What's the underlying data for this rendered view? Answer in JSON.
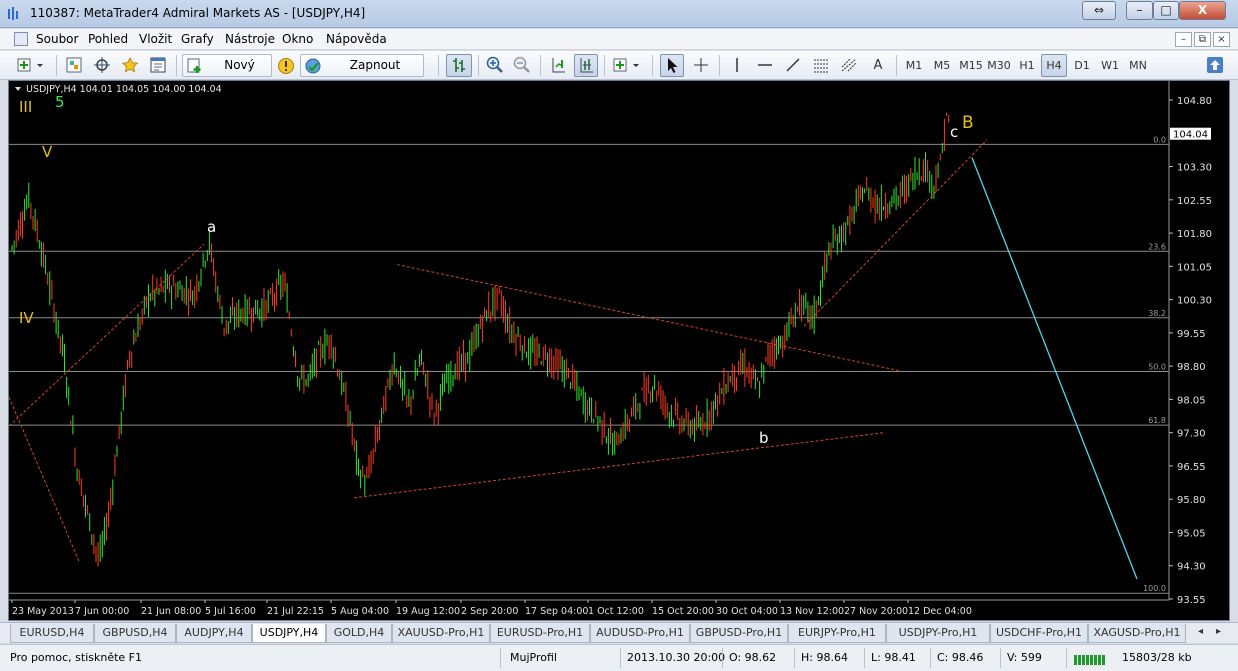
{
  "window": {
    "title": "110387: MetaTrader4 Admiral Markets AS - [USDJPY,H4]",
    "controls": {
      "minimize": "–",
      "maximize": "□",
      "close": "X",
      "restore": "⇔"
    }
  },
  "menu": {
    "items": [
      "Soubor",
      "Pohled",
      "Vložit",
      "Grafy",
      "Nástroje",
      "Okno",
      "Nápověda"
    ],
    "mdi_controls": [
      "–",
      "⧉",
      "×"
    ]
  },
  "toolbar": {
    "new_order_label": "Nový pokyn",
    "strategy_label": "Zapnout strategie",
    "text_tool": "A",
    "timeframes": [
      "M1",
      "M5",
      "M15",
      "M30",
      "H1",
      "H4",
      "D1",
      "W1",
      "MN"
    ],
    "active_timeframe": "H4"
  },
  "chart": {
    "symbol_header": "USDJPY,H4  104.01 104.05 104.00 104.04",
    "background": "#000000",
    "bull_color": "#2ee62e",
    "bear_color": "#ff3b1f",
    "price_axis": [
      "104.80",
      "103.30",
      "102.55",
      "101.80",
      "101.05",
      "100.30",
      "99.55",
      "98.80",
      "98.05",
      "97.30",
      "96.55",
      "95.80",
      "95.05",
      "94.30",
      "93.55"
    ],
    "current_price": "104.04",
    "time_axis": [
      "23 May 2013",
      "7 Jun 00:00",
      "21 Jun 08:00",
      "5 Jul 16:00",
      "21 Jul 22:15",
      "5 Aug 04:00",
      "19 Aug 12:00",
      "2 Sep 20:00",
      "17 Sep 04:00",
      "1 Oct 12:00",
      "15 Oct 20:00",
      "30 Oct 04:00",
      "13 Nov 12:00",
      "27 Nov 20:00",
      "12 Dec 04:00"
    ],
    "fib_levels": [
      "0.0",
      "23.6",
      "38.2",
      "50.0",
      "61.8",
      "100.0"
    ],
    "wave_labels": {
      "green_5": "5",
      "III": "III",
      "V": "V",
      "IV": "IV",
      "a": "a",
      "b": "b",
      "c": "c",
      "B": "B"
    }
  },
  "tabs": {
    "items": [
      "EURUSD,H4",
      "GBPUSD,H4",
      "AUDJPY,H4",
      "USDJPY,H4",
      "GOLD,H4",
      "XAUUSD-Pro,H1",
      "EURUSD-Pro,H1",
      "AUDUSD-Pro,H1",
      "GBPUSD-Pro,H1",
      "EURJPY-Pro,H1",
      "USDJPY-Pro,H1",
      "USDCHF-Pro,H1",
      "XAGUSD-Pro,H1"
    ],
    "active": "USDJPY,H4",
    "scroll_left": "◂",
    "scroll_right": "▸"
  },
  "status": {
    "help": "Pro pomoc, stiskněte F1",
    "profile": "MujProfil",
    "datetime": "2013.10.30 20:00",
    "open": "O: 98.62",
    "high": "H: 98.64",
    "low": "L: 98.41",
    "close": "C: 98.46",
    "volume": "V: 599",
    "traffic": "15803/28 kb"
  }
}
